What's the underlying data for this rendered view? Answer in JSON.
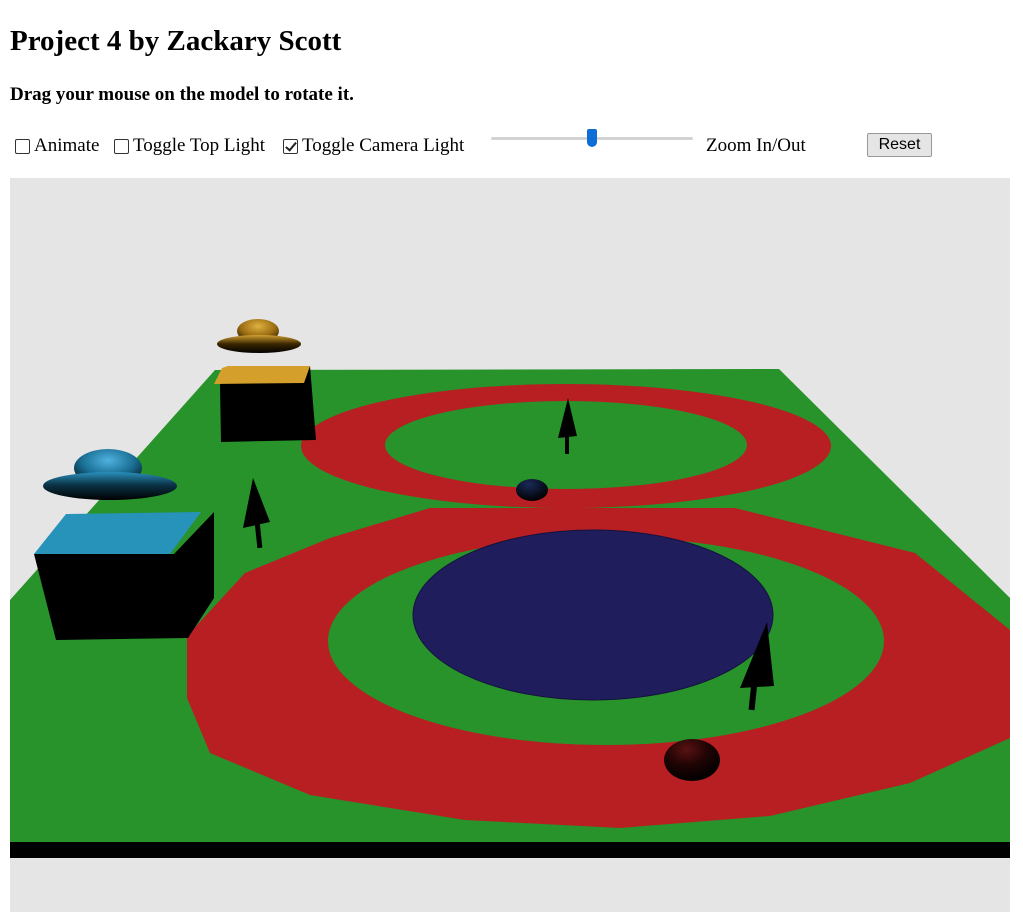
{
  "page": {
    "title": "Project 4 by Zackary Scott",
    "instructions": "Drag your mouse on the model to rotate it."
  },
  "controls": {
    "animate": {
      "label": "Animate",
      "checked": false
    },
    "top_light": {
      "label": "Toggle Top Light",
      "checked": false
    },
    "camera_light": {
      "label": "Toggle Camera Light",
      "checked": true
    },
    "zoom": {
      "label": "Zoom In/Out",
      "value_fraction": 0.5
    },
    "reset_label": "Reset"
  },
  "scene": {
    "colors": {
      "background": "#e5e5e5",
      "ground": "#27932a",
      "track": "#b81f22",
      "pond": "#201d5c",
      "box_top_blue": "#2893ba",
      "box_top_gold": "#d49f2a",
      "object": "#000000"
    },
    "objects": [
      "ground-plane",
      "figure-eight-track",
      "blue-pond",
      "black-box-blue-top",
      "black-box-gold-top",
      "blue-flying-saucer",
      "gold-flying-saucer",
      "trees",
      "spheres"
    ]
  }
}
